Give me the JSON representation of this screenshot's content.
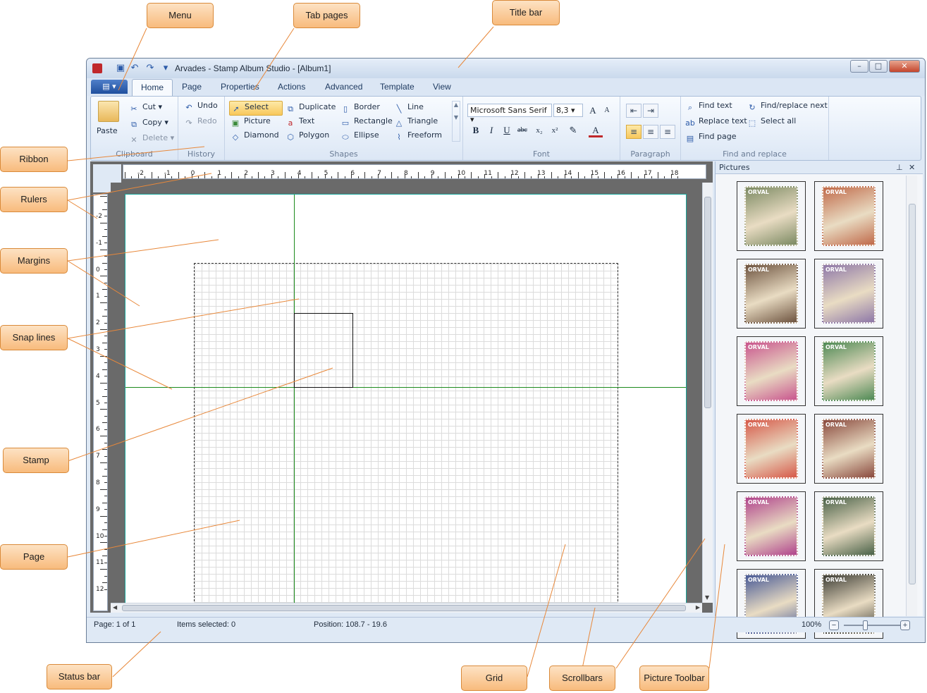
{
  "window": {
    "title": "Arvades - Stamp Album Studio - [Album1]",
    "minimize": "–",
    "maximize": "□",
    "close": "✕"
  },
  "app_menu": {
    "label": "▤ ▾"
  },
  "tabs": [
    "Home",
    "Page",
    "Properties",
    "Actions",
    "Advanced",
    "Template",
    "View"
  ],
  "ribbon": {
    "clipboard": {
      "label": "Clipboard",
      "paste": "Paste",
      "cut": "Cut",
      "copy": "Copy",
      "delete": "Delete"
    },
    "history": {
      "label": "History",
      "undo": "Undo",
      "redo": "Redo"
    },
    "shapes": {
      "label": "Shapes",
      "select": "Select",
      "picture": "Picture",
      "diamond": "Diamond",
      "duplicate": "Duplicate",
      "text": "Text",
      "polygon": "Polygon",
      "border": "Border",
      "rectangle": "Rectangle",
      "ellipse": "Ellipse",
      "line": "Line",
      "triangle": "Triangle",
      "freeform": "Freeform"
    },
    "font": {
      "label": "Font",
      "family": "Microsoft Sans Serif",
      "size": "8,3"
    },
    "paragraph": {
      "label": "Paragraph"
    },
    "find": {
      "label": "Find and replace",
      "find_text": "Find text",
      "replace_text": "Replace text",
      "find_page": "Find page",
      "find_replace_next": "Find/replace next",
      "select_all": "Select all"
    }
  },
  "rulers": {
    "h": [
      "-2",
      "-1",
      "0",
      "1",
      "2",
      "3",
      "4",
      "5",
      "6",
      "7",
      "8",
      "9",
      "10",
      "11",
      "12",
      "13",
      "14",
      "15",
      "16",
      "17",
      "18"
    ],
    "v": [
      "-2",
      "-1",
      "0",
      "1",
      "2",
      "3",
      "4",
      "5",
      "6",
      "7",
      "8",
      "9",
      "10",
      "11",
      "12"
    ]
  },
  "pictures_panel": {
    "title": "Pictures",
    "pin": "⊥",
    "close": "✕",
    "stamps": [
      {
        "name": "ORVAL",
        "color": "#7c8a63"
      },
      {
        "name": "ORVAL",
        "color": "#c06a4a"
      },
      {
        "name": "ORVAL",
        "color": "#6e5440"
      },
      {
        "name": "ORVAL",
        "color": "#8e78a8"
      },
      {
        "name": "ORVAL",
        "color": "#c9568e"
      },
      {
        "name": "ORVAL",
        "color": "#4f8a55"
      },
      {
        "name": "ORVAL",
        "color": "#d65a4a"
      },
      {
        "name": "ORVAL",
        "color": "#8a4a3e"
      },
      {
        "name": "ORVAL",
        "color": "#b0448c"
      },
      {
        "name": "ORVAL",
        "color": "#4a6248"
      },
      {
        "name": "ORVAL",
        "color": "#485a96"
      },
      {
        "name": "ORVAL",
        "color": "#3e3e36"
      }
    ]
  },
  "status": {
    "page": "Page: 1 of 1",
    "items": "Items selected: 0",
    "position": "Position: 108.7 - 19.6",
    "zoom": "100%",
    "zoom_out": "−",
    "zoom_in": "+"
  },
  "callouts": {
    "menu": "Menu",
    "tab_pages": "Tab pages",
    "title_bar": "Title bar",
    "ribbon": "Ribbon",
    "rulers": "Rulers",
    "margins": "Margins",
    "snap_lines": "Snap lines",
    "stamp": "Stamp",
    "page": "Page",
    "status_bar": "Status bar",
    "grid": "Grid",
    "scrollbars": "Scrollbars",
    "picture_toolbar": "Picture Toolbar"
  },
  "colors": {
    "accent": "#f8bb7d",
    "snap": "#1c8a1c",
    "margin": "#1aa59a"
  }
}
